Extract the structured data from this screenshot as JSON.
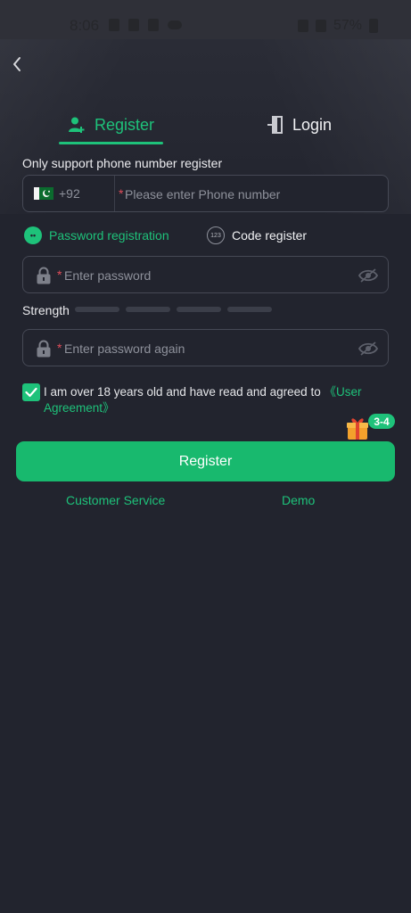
{
  "status_bar": {
    "time": "8:06",
    "battery": "57%"
  },
  "tabs": {
    "register": "Register",
    "login": "Login"
  },
  "hint": "Only support phone number register",
  "phone": {
    "code": "+92",
    "placeholder": "Please enter Phone number"
  },
  "modes": {
    "password": "Password registration",
    "code": "Code register",
    "code_icon_text": "123"
  },
  "password": {
    "placeholder": "Enter password"
  },
  "strength": {
    "label": "Strength",
    "level": 0
  },
  "password_again": {
    "placeholder": "Enter password again"
  },
  "agreement": {
    "text": "I am over 18 years old and have read and agreed to ",
    "link": "《User Agreement》",
    "checked": true
  },
  "promo": {
    "badge": "3-4"
  },
  "register_button": "Register",
  "footer": {
    "customer_service": "Customer Service",
    "demo": "Demo"
  },
  "colors": {
    "accent": "#1ec27a",
    "background": "#22242e",
    "required": "#e04d5a"
  }
}
